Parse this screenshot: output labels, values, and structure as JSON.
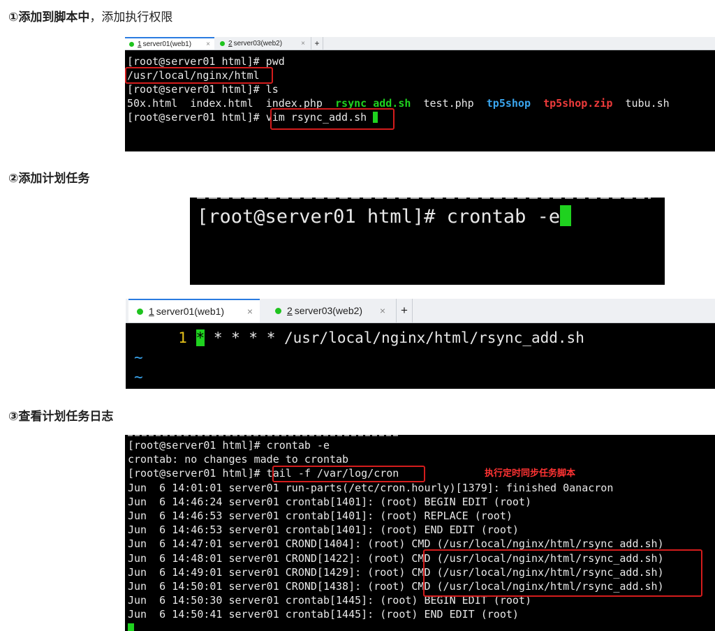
{
  "step1": {
    "heading_bold": "①添加到脚本中",
    "heading_rest": "，添加执行权限",
    "tabs": [
      {
        "num": "1",
        "label": "server01(web1)",
        "close": "×"
      },
      {
        "num": "2",
        "label": "server03(web2)",
        "close": "×"
      }
    ],
    "add_tab": "+",
    "lines": {
      "l1": "[root@server01 html]# pwd",
      "l2": "/usr/local/nginx/html",
      "l3": "[root@server01 html]# ls",
      "l5_prompt": "[root@server01 html]# ",
      "l5_cmd": "vim rsync_add.sh"
    },
    "files": [
      {
        "name": "50x.html",
        "color": "default"
      },
      {
        "name": "index.html",
        "color": "default"
      },
      {
        "name": "index.php",
        "color": "default"
      },
      {
        "name": "rsync_add.sh",
        "color": "green"
      },
      {
        "name": "test.php",
        "color": "default"
      },
      {
        "name": "tp5shop",
        "color": "blue"
      },
      {
        "name": "tp5shop.zip",
        "color": "red"
      },
      {
        "name": "tubu.sh",
        "color": "default"
      }
    ]
  },
  "step2": {
    "heading": "②添加计划任务",
    "cmd_prompt": "[root@server01 html]# ",
    "cmd_text": "crontab -e",
    "tabs": [
      {
        "num": "1",
        "label": "server01(web1)",
        "close": "×"
      },
      {
        "num": "2",
        "label": "server03(web2)",
        "close": "×"
      }
    ],
    "add_tab": "+",
    "editor_line_num": "1",
    "editor_cursor_char": "*",
    "editor_line_rest": " * * * * /usr/local/nginx/html/rsync_add.sh",
    "tilde": "~"
  },
  "step3": {
    "heading": "③查看计划任务日志",
    "annotation": "执行定时同步任务脚本",
    "lines": [
      "[root@server01 html]# crontab -e",
      "crontab: no changes made to crontab",
      "[root@server01 html]# tail -f /var/log/cron",
      "Jun  6 14:01:01 server01 run-parts(/etc/cron.hourly)[1379]: finished 0anacron",
      "Jun  6 14:46:24 server01 crontab[1401]: (root) BEGIN EDIT (root)",
      "Jun  6 14:46:53 server01 crontab[1401]: (root) REPLACE (root)",
      "Jun  6 14:46:53 server01 crontab[1401]: (root) END EDIT (root)",
      "Jun  6 14:47:01 server01 CROND[1404]: (root) CMD (/usr/local/nginx/html/rsync_add.sh)",
      "Jun  6 14:48:01 server01 CROND[1422]: (root) CMD (/usr/local/nginx/html/rsync_add.sh)",
      "Jun  6 14:49:01 server01 CROND[1429]: (root) CMD (/usr/local/nginx/html/rsync_add.sh)",
      "Jun  6 14:50:01 server01 CROND[1438]: (root) CMD (/usr/local/nginx/html/rsync_add.sh)",
      "Jun  6 14:50:30 server01 crontab[1445]: (root) BEGIN EDIT (root)",
      "Jun  6 14:50:41 server01 crontab[1445]: (root) END EDIT (root)"
    ]
  },
  "colors": {
    "terminal_bg": "#000000",
    "highlight_box": "#d41c1c",
    "exec_green": "#1fd21f",
    "dir_blue": "#3aa5ee",
    "archive_red": "#ee3b3b",
    "tab_accent": "#2a7be0"
  }
}
